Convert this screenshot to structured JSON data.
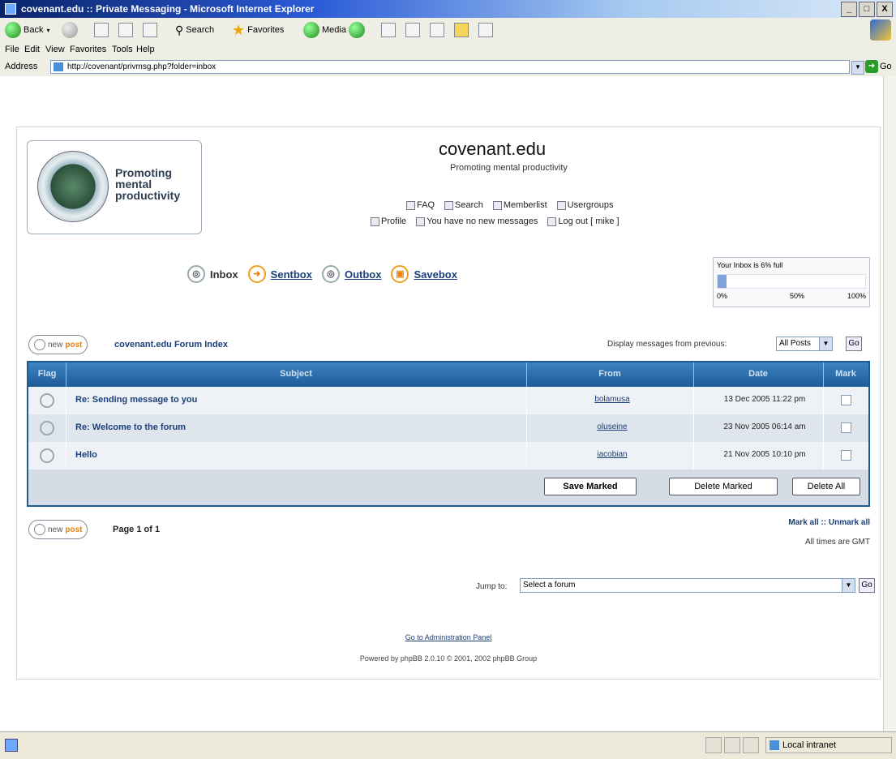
{
  "window": {
    "title": "covenant.edu :: Private Messaging - Microsoft Internet Explorer",
    "buttons": [
      "_",
      "□",
      "X"
    ]
  },
  "toolbar": {
    "back_label": "Back",
    "search_label": "Search",
    "favorites_label": "Favorites",
    "media_label": "Media"
  },
  "menu": [
    "File",
    "Edit",
    "View",
    "Favorites",
    "Tools",
    "Help"
  ],
  "address": {
    "label": "Address",
    "url": "http://covenant/privmsg.php?folder=inbox",
    "go_label": "Go"
  },
  "site": {
    "logo_text": "Promoting mental productivity",
    "title": "covenant.edu",
    "description": "Promoting mental productivity"
  },
  "nav": {
    "row1": [
      "FAQ",
      "Search",
      "Memberlist",
      "Usergroups"
    ],
    "row2": [
      "Profile",
      "You have no new messages",
      "Log out [ mike ]"
    ]
  },
  "folders": {
    "inbox": "Inbox",
    "sentbox": "Sentbox",
    "outbox": "Outbox",
    "savebox": "Savebox"
  },
  "quota": {
    "title": "Your Inbox is 6% full",
    "percent": 6,
    "label_0": "0%",
    "label_50": "50%",
    "label_100": "100%"
  },
  "newpost": {
    "new": "new",
    "post": "post"
  },
  "forum_index": "covenant.edu Forum Index",
  "display": {
    "label": "Display messages from previous:",
    "selected": "All Posts",
    "go": "Go"
  },
  "table": {
    "headers": {
      "flag": "Flag",
      "subject": "Subject",
      "from": "From",
      "date": "Date",
      "mark": "Mark"
    },
    "rows": [
      {
        "subject": "Re: Sending message to you",
        "from": "bolamusa",
        "date": "13 Dec 2005 11:22 pm"
      },
      {
        "subject": "Re: Welcome to the forum",
        "from": "oluseine",
        "date": "23 Nov 2005 06:14 am"
      },
      {
        "subject": "Hello",
        "from": "iacobian",
        "date": "21 Nov 2005 10:10 pm"
      }
    ],
    "buttons": {
      "save": "Save Marked",
      "delete_marked": "Delete Marked",
      "delete_all": "Delete All"
    }
  },
  "pagination": "Page 1 of 1",
  "mark_all": "Mark all :: Unmark all",
  "timezone": "All times are GMT",
  "jump": {
    "label": "Jump to:",
    "selected": "Select a forum",
    "go": "Go"
  },
  "footer": {
    "admin_link": "Go to Administration Panel",
    "powered": "Powered by phpBB 2.0.10 © 2001, 2002 phpBB Group"
  },
  "status": {
    "zone": "Local intranet"
  }
}
